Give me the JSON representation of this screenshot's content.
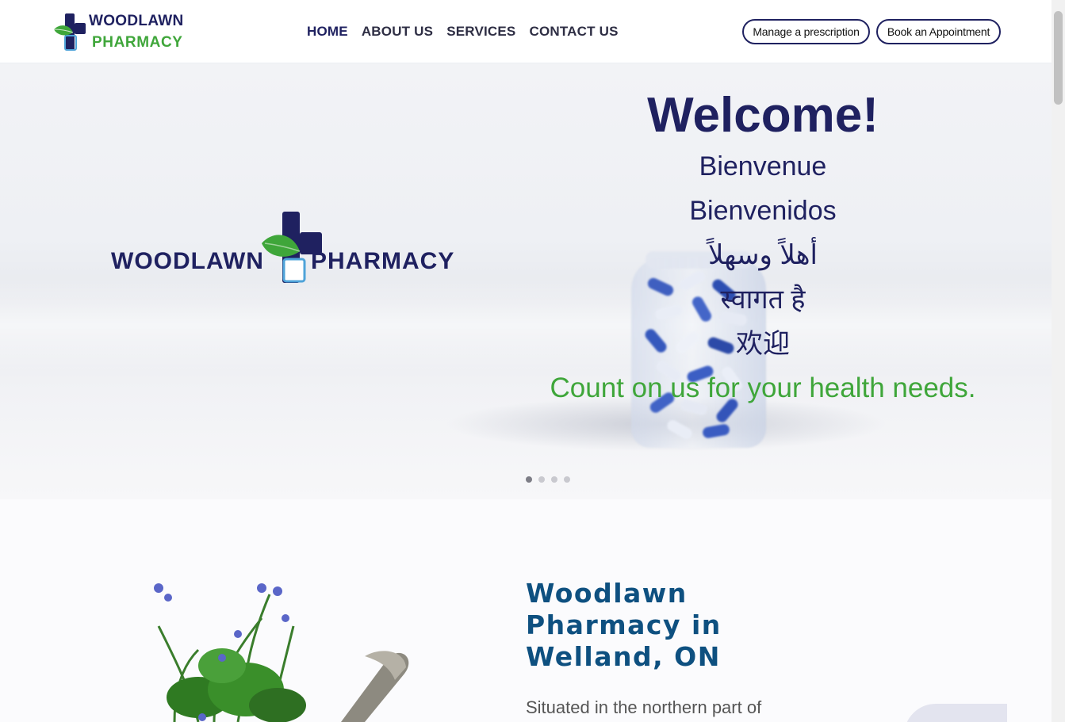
{
  "header": {
    "logo_line1": "WOODLAWN",
    "logo_line2": "PHARMACY",
    "nav": [
      {
        "label": "HOME"
      },
      {
        "label": "ABOUT US"
      },
      {
        "label": "SERVICES"
      },
      {
        "label": "CONTACT US"
      }
    ],
    "manage_prescription_label": "Manage a prescription",
    "book_appointment_label": "Book an Appointment"
  },
  "hero": {
    "logo_word_left": "WOODLAWN",
    "logo_word_right": "PHARMACY",
    "welcome": "Welcome!",
    "greetings": [
      "Bienvenue",
      "Bienvenidos",
      "أهلاً وسهلاً",
      "स्वागत है",
      "欢迎"
    ],
    "tagline": "Count on us for your health needs.",
    "slider": {
      "total": 4,
      "active": 1
    }
  },
  "about": {
    "title_line1": "Woodlawn",
    "title_line2": "Pharmacy in",
    "title_line3": "Welland, ON",
    "intro": "Situated in the northern part of"
  },
  "colors": {
    "brand_navy": "#1f2160",
    "brand_green": "#3fa63a",
    "heading_blue": "#0e5080"
  }
}
